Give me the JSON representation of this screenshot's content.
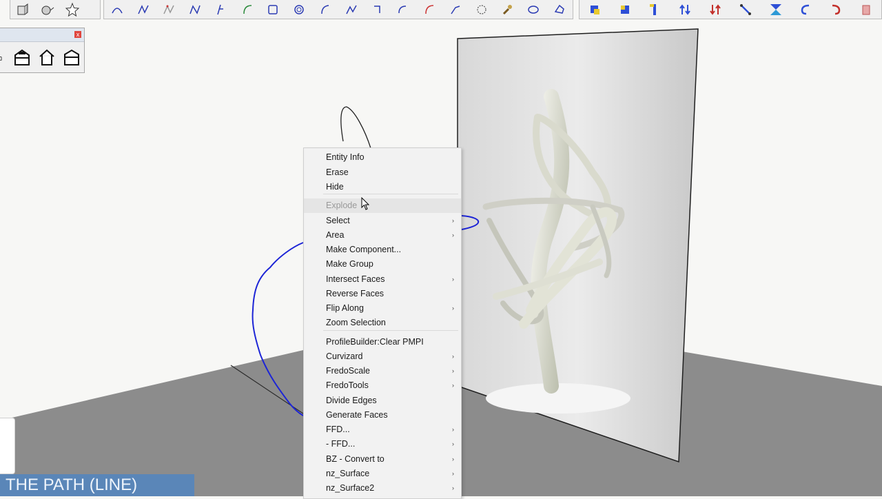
{
  "colors": {
    "toolbar_bg": "#f0f0f0",
    "ground": "#8c8c8c",
    "path_line": "#1c24d6",
    "menu_bg": "#f2f2f2",
    "caption_bg": "#5a86b8"
  },
  "toolbar_left": {
    "icons": [
      "push-pull-icon",
      "follow-me-icon",
      "star-tool-icon"
    ]
  },
  "toolbar_center": {
    "icons": [
      "arc-icon",
      "freehand-icon",
      "bezier-icon",
      "polyline-icon",
      "spline-icon",
      "arc-2pt-icon",
      "rectangle-icon",
      "spiral-icon",
      "arc-3pt-icon",
      "curve-icon",
      "corner-icon",
      "fillet-icon",
      "arc-red-icon",
      "line-icon",
      "circle-icon",
      "wrench-icon",
      "ellipse-icon",
      "polygon-icon"
    ]
  },
  "toolbar_right": {
    "icons": [
      "move-icon",
      "rotate-icon",
      "scale-icon",
      "align-icon",
      "flip-icon",
      "stretch-icon",
      "mirror-icon",
      "undo-icon",
      "redo-icon",
      "erase-icon"
    ]
  },
  "floating_toolbar": {
    "close_label": "x",
    "icons": [
      "house-partial-icon",
      "warehouse-icon",
      "house-icon",
      "garage-icon"
    ]
  },
  "context_menu": {
    "items": [
      {
        "label": "Entity Info",
        "submenu": false,
        "disabled": false
      },
      {
        "label": "Erase",
        "submenu": false,
        "disabled": false
      },
      {
        "label": "Hide",
        "submenu": false,
        "disabled": false
      },
      {
        "label": "Explode",
        "submenu": false,
        "disabled": true
      },
      {
        "label": "Select",
        "submenu": true,
        "disabled": false
      },
      {
        "label": "Area",
        "submenu": true,
        "disabled": false
      },
      {
        "label": "Make Component...",
        "submenu": false,
        "disabled": false
      },
      {
        "label": "Make Group",
        "submenu": false,
        "disabled": false
      },
      {
        "label": "Intersect Faces",
        "submenu": true,
        "disabled": false
      },
      {
        "label": "Reverse Faces",
        "submenu": false,
        "disabled": false
      },
      {
        "label": "Flip Along",
        "submenu": true,
        "disabled": false
      },
      {
        "label": "Zoom Selection",
        "submenu": false,
        "disabled": false
      },
      {
        "label": "ProfileBuilder:Clear PMPI",
        "submenu": false,
        "disabled": false
      },
      {
        "label": "Curvizard",
        "submenu": true,
        "disabled": false
      },
      {
        "label": "FredoScale",
        "submenu": true,
        "disabled": false
      },
      {
        "label": "FredoTools",
        "submenu": true,
        "disabled": false
      },
      {
        "label": "Divide Edges",
        "submenu": false,
        "disabled": false
      },
      {
        "label": "Generate Faces",
        "submenu": false,
        "disabled": false
      },
      {
        "label": "FFD...",
        "submenu": true,
        "disabled": false
      },
      {
        "label": "- FFD...",
        "submenu": true,
        "disabled": false
      },
      {
        "label": "BZ - Convert to",
        "submenu": true,
        "disabled": false
      },
      {
        "label": "nz_Surface",
        "submenu": true,
        "disabled": false
      },
      {
        "label": "nz_Surface2",
        "submenu": true,
        "disabled": false
      }
    ],
    "submenu_arrow": "›"
  },
  "caption": {
    "text": "THE PATH (LINE)"
  }
}
